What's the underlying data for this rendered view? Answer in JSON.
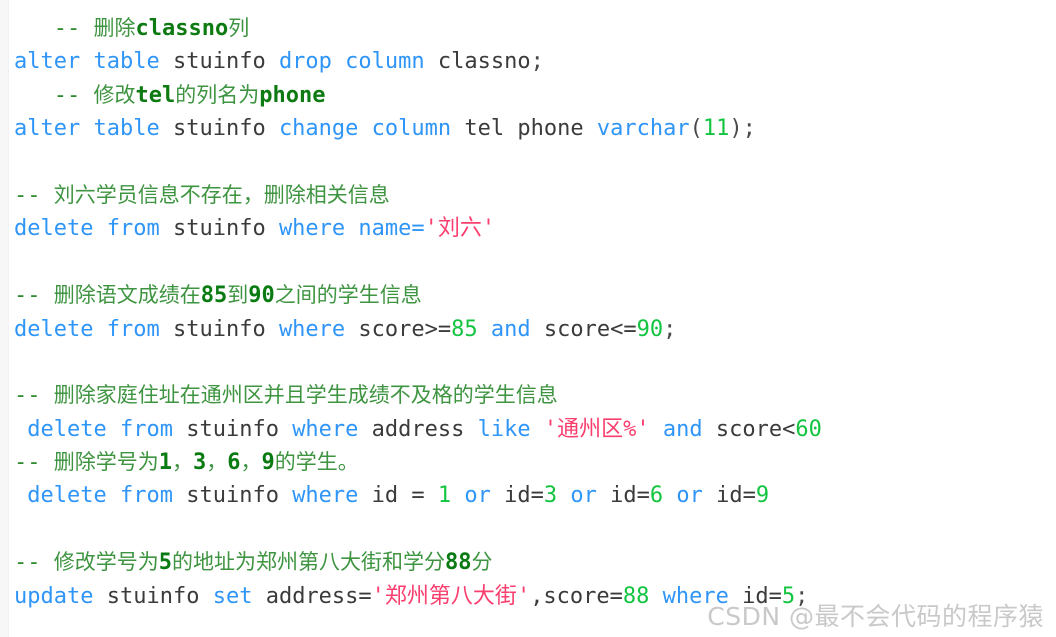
{
  "language": "sql",
  "background": "#ffffff",
  "colors": {
    "keyword": "#2f95f7",
    "identifier": "#3b3b3b",
    "number": "#12c43f",
    "string": "#fa3e6e",
    "comment": "#2e8b30",
    "comment_emphasis": "#0d7a12",
    "punctuation": "#4a4a4a",
    "watermark": "#c9c9c9",
    "gutter": "#f7f7f8"
  },
  "watermark": {
    "text": "CSDN @最不会代码的程序猿"
  },
  "lines": [
    {
      "index": 1,
      "type": "comment",
      "text": "   -- 删除classno列",
      "tokens": [
        {
          "t": "   ",
          "k": "com"
        },
        {
          "t": "-- ",
          "k": "com"
        },
        {
          "t": "删除",
          "k": "com-cjk"
        },
        {
          "t": "classno",
          "k": "com-ascii"
        },
        {
          "t": "列",
          "k": "com-cjk"
        }
      ]
    },
    {
      "index": 2,
      "type": "code",
      "text": "alter table stuinfo drop column classno;",
      "tokens": [
        {
          "t": "alter",
          "k": "kw"
        },
        {
          "t": " ",
          "k": "id"
        },
        {
          "t": "table",
          "k": "kw"
        },
        {
          "t": " ",
          "k": "id"
        },
        {
          "t": "stuinfo",
          "k": "id"
        },
        {
          "t": " ",
          "k": "id"
        },
        {
          "t": "drop",
          "k": "kw"
        },
        {
          "t": " ",
          "k": "id"
        },
        {
          "t": "column",
          "k": "kw"
        },
        {
          "t": " ",
          "k": "id"
        },
        {
          "t": "classno",
          "k": "id"
        },
        {
          "t": ";",
          "k": "punc"
        }
      ]
    },
    {
      "index": 3,
      "type": "comment",
      "text": "   -- 修改tel的列名为phone",
      "tokens": [
        {
          "t": "   ",
          "k": "com"
        },
        {
          "t": "-- ",
          "k": "com"
        },
        {
          "t": "修改",
          "k": "com-cjk"
        },
        {
          "t": "tel",
          "k": "com-ascii"
        },
        {
          "t": "的列名为",
          "k": "com-cjk"
        },
        {
          "t": "phone",
          "k": "com-ascii"
        }
      ]
    },
    {
      "index": 4,
      "type": "code",
      "text": "alter table stuinfo change column tel phone varchar(11);",
      "tokens": [
        {
          "t": "alter",
          "k": "kw"
        },
        {
          "t": " ",
          "k": "id"
        },
        {
          "t": "table",
          "k": "kw"
        },
        {
          "t": " ",
          "k": "id"
        },
        {
          "t": "stuinfo",
          "k": "id"
        },
        {
          "t": " ",
          "k": "id"
        },
        {
          "t": "change",
          "k": "kw"
        },
        {
          "t": " ",
          "k": "id"
        },
        {
          "t": "column",
          "k": "kw"
        },
        {
          "t": " ",
          "k": "id"
        },
        {
          "t": "tel",
          "k": "id"
        },
        {
          "t": " ",
          "k": "id"
        },
        {
          "t": "phone",
          "k": "id"
        },
        {
          "t": " ",
          "k": "id"
        },
        {
          "t": "varchar",
          "k": "kw"
        },
        {
          "t": "(",
          "k": "punc"
        },
        {
          "t": "11",
          "k": "num"
        },
        {
          "t": ");",
          "k": "punc"
        }
      ]
    },
    {
      "index": 5,
      "type": "blank",
      "text": "",
      "tokens": []
    },
    {
      "index": 6,
      "type": "comment",
      "text": "-- 刘六学员信息不存在，删除相关信息",
      "tokens": [
        {
          "t": "-- ",
          "k": "com"
        },
        {
          "t": "刘六学员信息不存在，删除相关信息",
          "k": "com-cjk"
        }
      ]
    },
    {
      "index": 7,
      "type": "code",
      "text": "delete from stuinfo where name='刘六'",
      "tokens": [
        {
          "t": "delete",
          "k": "kw"
        },
        {
          "t": " ",
          "k": "id"
        },
        {
          "t": "from",
          "k": "kw"
        },
        {
          "t": " ",
          "k": "id"
        },
        {
          "t": "stuinfo",
          "k": "id"
        },
        {
          "t": " ",
          "k": "id"
        },
        {
          "t": "where",
          "k": "kw"
        },
        {
          "t": " ",
          "k": "id"
        },
        {
          "t": "name",
          "k": "kw"
        },
        {
          "t": "=",
          "k": "kw"
        },
        {
          "t": "'",
          "k": "str"
        },
        {
          "t": "刘六",
          "k": "str-cjk"
        },
        {
          "t": "'",
          "k": "str"
        }
      ]
    },
    {
      "index": 8,
      "type": "blank",
      "text": "",
      "tokens": []
    },
    {
      "index": 9,
      "type": "comment",
      "text": "-- 删除语文成绩在85到90之间的学生信息",
      "tokens": [
        {
          "t": "-- ",
          "k": "com"
        },
        {
          "t": "删除语文成绩在",
          "k": "com-cjk"
        },
        {
          "t": "85",
          "k": "com-num"
        },
        {
          "t": "到",
          "k": "com-cjk"
        },
        {
          "t": "90",
          "k": "com-num"
        },
        {
          "t": "之间的学生信息",
          "k": "com-cjk"
        }
      ]
    },
    {
      "index": 10,
      "type": "code",
      "text": "delete from stuinfo where score>=85 and score<=90;",
      "tokens": [
        {
          "t": "delete",
          "k": "kw"
        },
        {
          "t": " ",
          "k": "id"
        },
        {
          "t": "from",
          "k": "kw"
        },
        {
          "t": " ",
          "k": "id"
        },
        {
          "t": "stuinfo",
          "k": "id"
        },
        {
          "t": " ",
          "k": "id"
        },
        {
          "t": "where",
          "k": "kw"
        },
        {
          "t": " ",
          "k": "id"
        },
        {
          "t": "score>=",
          "k": "id"
        },
        {
          "t": "85",
          "k": "num"
        },
        {
          "t": " ",
          "k": "id"
        },
        {
          "t": "and",
          "k": "kw"
        },
        {
          "t": " ",
          "k": "id"
        },
        {
          "t": "score<=",
          "k": "id"
        },
        {
          "t": "90",
          "k": "num"
        },
        {
          "t": ";",
          "k": "punc"
        }
      ]
    },
    {
      "index": 11,
      "type": "blank",
      "text": "",
      "tokens": []
    },
    {
      "index": 12,
      "type": "comment",
      "text": "-- 删除家庭住址在通州区并且学生成绩不及格的学生信息",
      "tokens": [
        {
          "t": "-- ",
          "k": "com"
        },
        {
          "t": "删除家庭住址在通州区并且学生成绩不及格的学生信息",
          "k": "com-cjk"
        }
      ]
    },
    {
      "index": 13,
      "type": "code",
      "text": " delete from stuinfo where address like '通州区%' and score<60",
      "tokens": [
        {
          "t": " ",
          "k": "id"
        },
        {
          "t": "delete",
          "k": "kw"
        },
        {
          "t": " ",
          "k": "id"
        },
        {
          "t": "from",
          "k": "kw"
        },
        {
          "t": " ",
          "k": "id"
        },
        {
          "t": "stuinfo",
          "k": "id"
        },
        {
          "t": " ",
          "k": "id"
        },
        {
          "t": "where",
          "k": "kw"
        },
        {
          "t": " ",
          "k": "id"
        },
        {
          "t": "address",
          "k": "id"
        },
        {
          "t": " ",
          "k": "id"
        },
        {
          "t": "like",
          "k": "kw"
        },
        {
          "t": " ",
          "k": "id"
        },
        {
          "t": "'",
          "k": "str"
        },
        {
          "t": "通州区",
          "k": "str-cjk"
        },
        {
          "t": "%'",
          "k": "str"
        },
        {
          "t": " ",
          "k": "id"
        },
        {
          "t": "and",
          "k": "kw"
        },
        {
          "t": " ",
          "k": "id"
        },
        {
          "t": "score<",
          "k": "id"
        },
        {
          "t": "60",
          "k": "num"
        }
      ]
    },
    {
      "index": 14,
      "type": "comment",
      "text": "-- 删除学号为1, 3, 6, 9的学生。",
      "tokens": [
        {
          "t": "-- ",
          "k": "com"
        },
        {
          "t": "删除学号为",
          "k": "com-cjk"
        },
        {
          "t": "1",
          "k": "com-num"
        },
        {
          "t": "，",
          "k": "com-cjk"
        },
        {
          "t": "3",
          "k": "com-num"
        },
        {
          "t": "，",
          "k": "com-cjk"
        },
        {
          "t": "6",
          "k": "com-num"
        },
        {
          "t": "，",
          "k": "com-cjk"
        },
        {
          "t": "9",
          "k": "com-num"
        },
        {
          "t": "的学生。",
          "k": "com-cjk"
        }
      ]
    },
    {
      "index": 15,
      "type": "code",
      "text": " delete from stuinfo where id = 1 or id=3 or id=6 or id=9",
      "tokens": [
        {
          "t": " ",
          "k": "id"
        },
        {
          "t": "delete",
          "k": "kw"
        },
        {
          "t": " ",
          "k": "id"
        },
        {
          "t": "from",
          "k": "kw"
        },
        {
          "t": " ",
          "k": "id"
        },
        {
          "t": "stuinfo",
          "k": "id"
        },
        {
          "t": " ",
          "k": "id"
        },
        {
          "t": "where",
          "k": "kw"
        },
        {
          "t": " ",
          "k": "id"
        },
        {
          "t": "id = ",
          "k": "id"
        },
        {
          "t": "1",
          "k": "num"
        },
        {
          "t": " ",
          "k": "id"
        },
        {
          "t": "or",
          "k": "kw"
        },
        {
          "t": " ",
          "k": "id"
        },
        {
          "t": "id=",
          "k": "id"
        },
        {
          "t": "3",
          "k": "num"
        },
        {
          "t": " ",
          "k": "id"
        },
        {
          "t": "or",
          "k": "kw"
        },
        {
          "t": " ",
          "k": "id"
        },
        {
          "t": "id=",
          "k": "id"
        },
        {
          "t": "6",
          "k": "num"
        },
        {
          "t": " ",
          "k": "id"
        },
        {
          "t": "or",
          "k": "kw"
        },
        {
          "t": " ",
          "k": "id"
        },
        {
          "t": "id=",
          "k": "id"
        },
        {
          "t": "9",
          "k": "num"
        }
      ]
    },
    {
      "index": 16,
      "type": "blank",
      "text": "",
      "tokens": []
    },
    {
      "index": 17,
      "type": "comment",
      "text": "-- 修改学号为5的地址为郑州第八大街和学分88分",
      "tokens": [
        {
          "t": "-- ",
          "k": "com"
        },
        {
          "t": "修改学号为",
          "k": "com-cjk"
        },
        {
          "t": "5",
          "k": "com-num"
        },
        {
          "t": "的地址为郑州第八大街和学分",
          "k": "com-cjk"
        },
        {
          "t": "88",
          "k": "com-num"
        },
        {
          "t": "分",
          "k": "com-cjk"
        }
      ]
    },
    {
      "index": 18,
      "type": "code",
      "text": "update stuinfo set address='郑州第八大街',score=88 where id=5;",
      "tokens": [
        {
          "t": "update",
          "k": "kw"
        },
        {
          "t": " ",
          "k": "id"
        },
        {
          "t": "stuinfo",
          "k": "id"
        },
        {
          "t": " ",
          "k": "id"
        },
        {
          "t": "set",
          "k": "kw"
        },
        {
          "t": " ",
          "k": "id"
        },
        {
          "t": "address=",
          "k": "id"
        },
        {
          "t": "'",
          "k": "str"
        },
        {
          "t": "郑州第八大街",
          "k": "str-cjk"
        },
        {
          "t": "'",
          "k": "str"
        },
        {
          "t": ",score=",
          "k": "id"
        },
        {
          "t": "88",
          "k": "num"
        },
        {
          "t": " ",
          "k": "id"
        },
        {
          "t": "where",
          "k": "kw"
        },
        {
          "t": " ",
          "k": "id"
        },
        {
          "t": "id=",
          "k": "id"
        },
        {
          "t": "5",
          "k": "num"
        },
        {
          "t": ";",
          "k": "punc"
        }
      ]
    }
  ]
}
